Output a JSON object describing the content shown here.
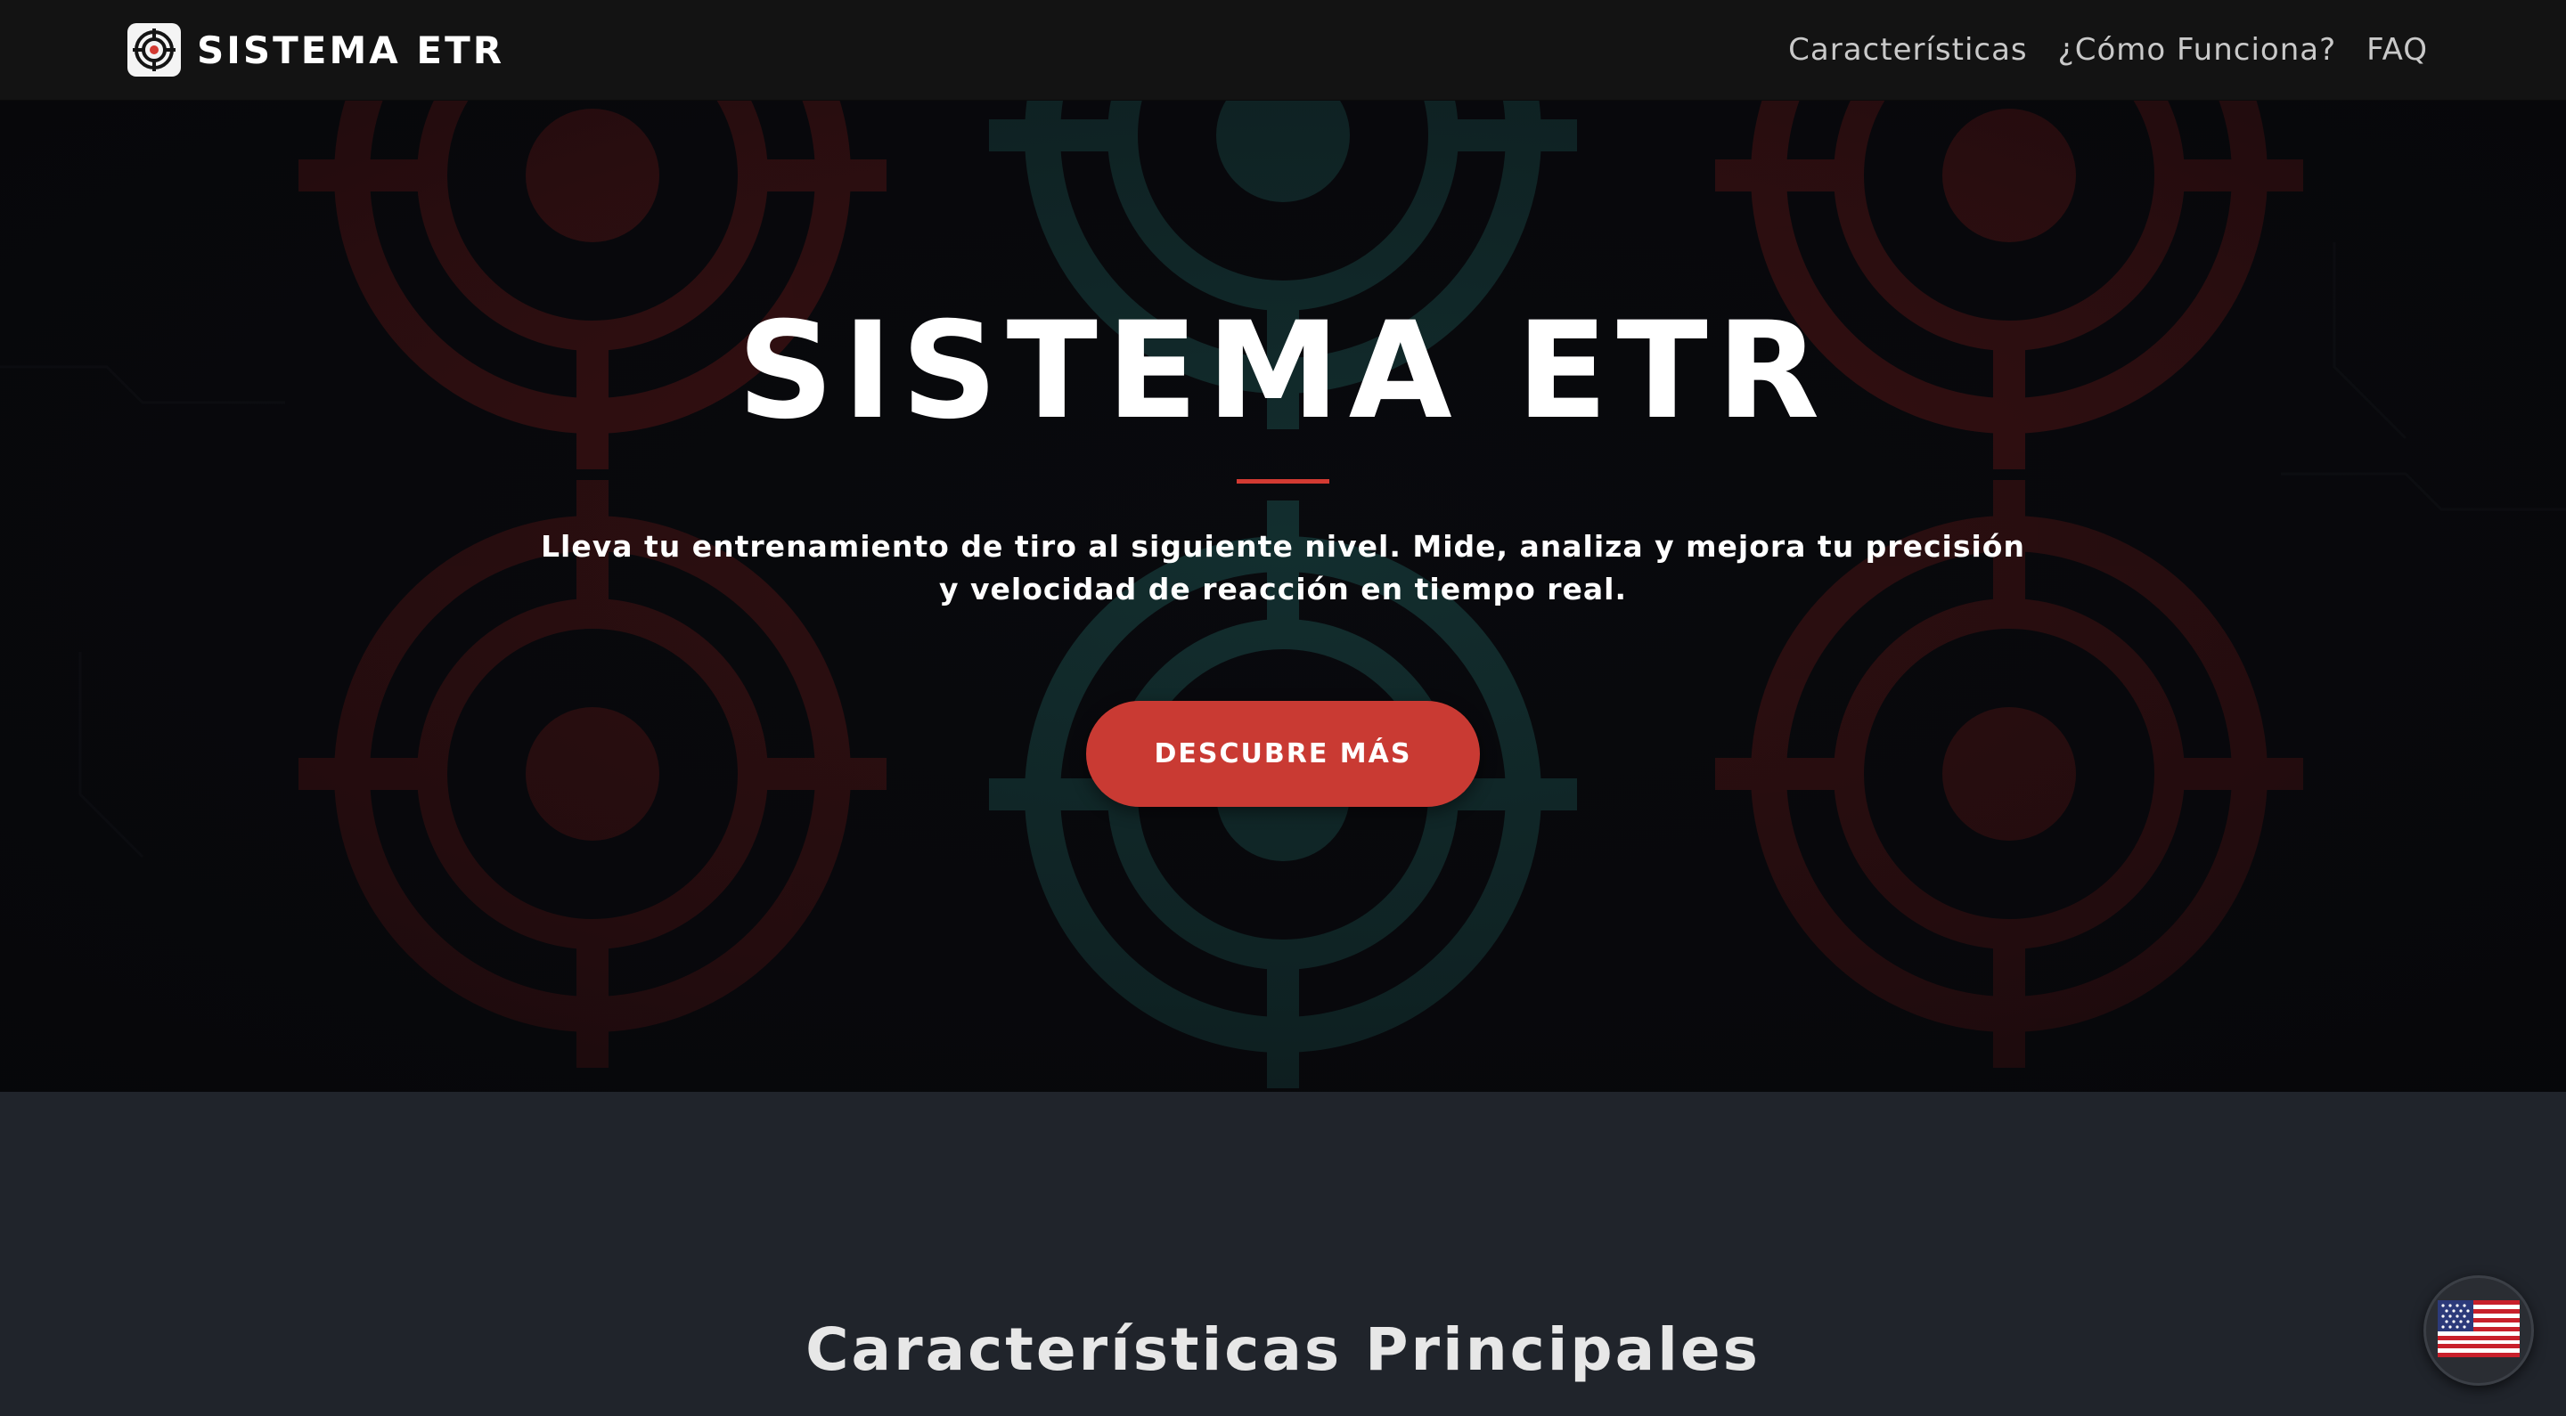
{
  "navbar": {
    "brand": "SISTEMA ETR",
    "brand_icon": "target-crosshair-icon",
    "links": [
      {
        "label": "Características"
      },
      {
        "label": "¿Cómo Funciona?"
      },
      {
        "label": "FAQ"
      }
    ]
  },
  "hero": {
    "title": "SISTEMA ETR",
    "subtitle": "Lleva tu entrenamiento de tiro al siguiente nivel. Mide, analiza y mejora tu precisión y velocidad de reacción en tiempo real.",
    "cta_label": "DESCUBRE MÁS",
    "background": "target-pattern-image"
  },
  "features": {
    "title": "Características Principales"
  },
  "language": {
    "icon": "us-flag-icon"
  },
  "colors": {
    "accent": "#c93a33",
    "navbar_bg": "#131313",
    "section_bg": "#20242b",
    "target_red": "#7a1c1c",
    "target_teal": "#1f5552"
  }
}
